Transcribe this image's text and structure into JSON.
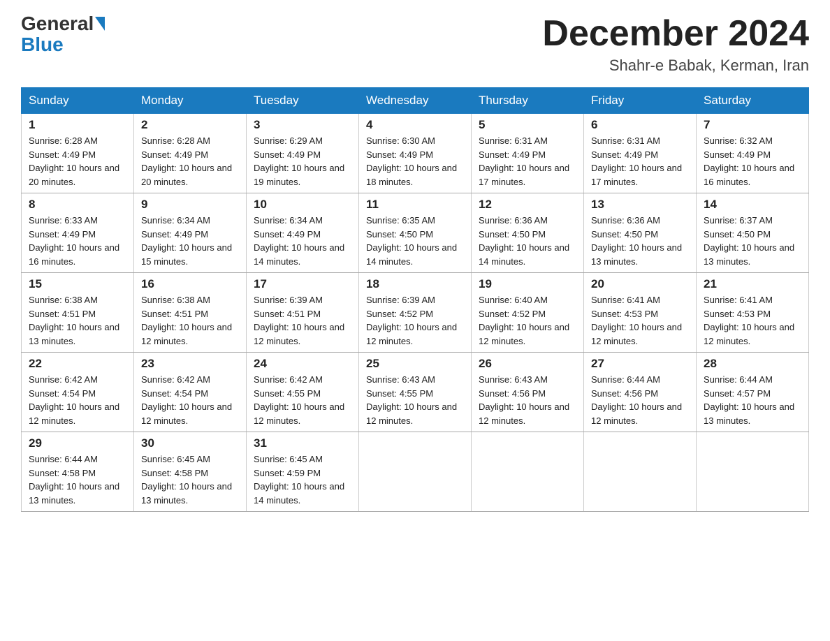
{
  "header": {
    "logo_general": "General",
    "logo_blue": "Blue",
    "month_title": "December 2024",
    "location": "Shahr-e Babak, Kerman, Iran"
  },
  "weekdays": [
    "Sunday",
    "Monday",
    "Tuesday",
    "Wednesday",
    "Thursday",
    "Friday",
    "Saturday"
  ],
  "weeks": [
    [
      {
        "day": "1",
        "sunrise": "6:28 AM",
        "sunset": "4:49 PM",
        "daylight": "10 hours and 20 minutes."
      },
      {
        "day": "2",
        "sunrise": "6:28 AM",
        "sunset": "4:49 PM",
        "daylight": "10 hours and 20 minutes."
      },
      {
        "day": "3",
        "sunrise": "6:29 AM",
        "sunset": "4:49 PM",
        "daylight": "10 hours and 19 minutes."
      },
      {
        "day": "4",
        "sunrise": "6:30 AM",
        "sunset": "4:49 PM",
        "daylight": "10 hours and 18 minutes."
      },
      {
        "day": "5",
        "sunrise": "6:31 AM",
        "sunset": "4:49 PM",
        "daylight": "10 hours and 17 minutes."
      },
      {
        "day": "6",
        "sunrise": "6:31 AM",
        "sunset": "4:49 PM",
        "daylight": "10 hours and 17 minutes."
      },
      {
        "day": "7",
        "sunrise": "6:32 AM",
        "sunset": "4:49 PM",
        "daylight": "10 hours and 16 minutes."
      }
    ],
    [
      {
        "day": "8",
        "sunrise": "6:33 AM",
        "sunset": "4:49 PM",
        "daylight": "10 hours and 16 minutes."
      },
      {
        "day": "9",
        "sunrise": "6:34 AM",
        "sunset": "4:49 PM",
        "daylight": "10 hours and 15 minutes."
      },
      {
        "day": "10",
        "sunrise": "6:34 AM",
        "sunset": "4:49 PM",
        "daylight": "10 hours and 14 minutes."
      },
      {
        "day": "11",
        "sunrise": "6:35 AM",
        "sunset": "4:50 PM",
        "daylight": "10 hours and 14 minutes."
      },
      {
        "day": "12",
        "sunrise": "6:36 AM",
        "sunset": "4:50 PM",
        "daylight": "10 hours and 14 minutes."
      },
      {
        "day": "13",
        "sunrise": "6:36 AM",
        "sunset": "4:50 PM",
        "daylight": "10 hours and 13 minutes."
      },
      {
        "day": "14",
        "sunrise": "6:37 AM",
        "sunset": "4:50 PM",
        "daylight": "10 hours and 13 minutes."
      }
    ],
    [
      {
        "day": "15",
        "sunrise": "6:38 AM",
        "sunset": "4:51 PM",
        "daylight": "10 hours and 13 minutes."
      },
      {
        "day": "16",
        "sunrise": "6:38 AM",
        "sunset": "4:51 PM",
        "daylight": "10 hours and 12 minutes."
      },
      {
        "day": "17",
        "sunrise": "6:39 AM",
        "sunset": "4:51 PM",
        "daylight": "10 hours and 12 minutes."
      },
      {
        "day": "18",
        "sunrise": "6:39 AM",
        "sunset": "4:52 PM",
        "daylight": "10 hours and 12 minutes."
      },
      {
        "day": "19",
        "sunrise": "6:40 AM",
        "sunset": "4:52 PM",
        "daylight": "10 hours and 12 minutes."
      },
      {
        "day": "20",
        "sunrise": "6:41 AM",
        "sunset": "4:53 PM",
        "daylight": "10 hours and 12 minutes."
      },
      {
        "day": "21",
        "sunrise": "6:41 AM",
        "sunset": "4:53 PM",
        "daylight": "10 hours and 12 minutes."
      }
    ],
    [
      {
        "day": "22",
        "sunrise": "6:42 AM",
        "sunset": "4:54 PM",
        "daylight": "10 hours and 12 minutes."
      },
      {
        "day": "23",
        "sunrise": "6:42 AM",
        "sunset": "4:54 PM",
        "daylight": "10 hours and 12 minutes."
      },
      {
        "day": "24",
        "sunrise": "6:42 AM",
        "sunset": "4:55 PM",
        "daylight": "10 hours and 12 minutes."
      },
      {
        "day": "25",
        "sunrise": "6:43 AM",
        "sunset": "4:55 PM",
        "daylight": "10 hours and 12 minutes."
      },
      {
        "day": "26",
        "sunrise": "6:43 AM",
        "sunset": "4:56 PM",
        "daylight": "10 hours and 12 minutes."
      },
      {
        "day": "27",
        "sunrise": "6:44 AM",
        "sunset": "4:56 PM",
        "daylight": "10 hours and 12 minutes."
      },
      {
        "day": "28",
        "sunrise": "6:44 AM",
        "sunset": "4:57 PM",
        "daylight": "10 hours and 13 minutes."
      }
    ],
    [
      {
        "day": "29",
        "sunrise": "6:44 AM",
        "sunset": "4:58 PM",
        "daylight": "10 hours and 13 minutes."
      },
      {
        "day": "30",
        "sunrise": "6:45 AM",
        "sunset": "4:58 PM",
        "daylight": "10 hours and 13 minutes."
      },
      {
        "day": "31",
        "sunrise": "6:45 AM",
        "sunset": "4:59 PM",
        "daylight": "10 hours and 14 minutes."
      },
      null,
      null,
      null,
      null
    ]
  ]
}
